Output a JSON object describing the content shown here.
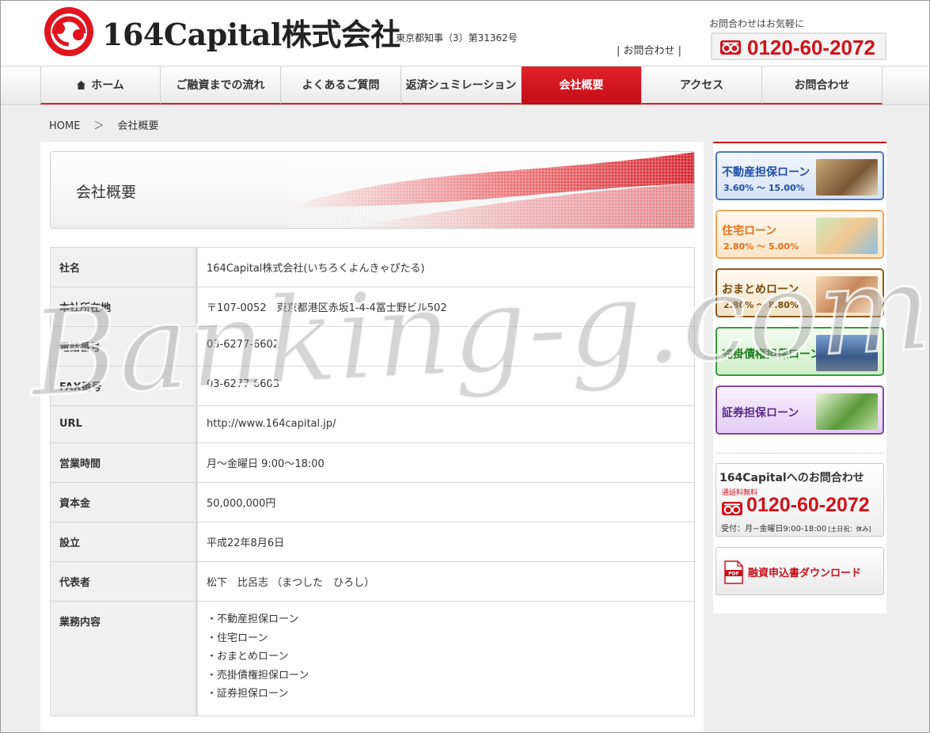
{
  "header": {
    "logo_text": "164Capital株式会社",
    "license": "東京都知事（3）第31362号",
    "contact_note": "お問合わせはお気軽に",
    "contact_link": "| お問合わせ |",
    "tel": "0120-60-2072"
  },
  "nav": {
    "items": [
      {
        "label": "ホーム",
        "icon": "home-icon",
        "active": false
      },
      {
        "label": "ご融資までの流れ",
        "active": false
      },
      {
        "label": "よくあるご質問",
        "active": false
      },
      {
        "label": "返済シュミレーション",
        "active": false
      },
      {
        "label": "会社概要",
        "active": true
      },
      {
        "label": "アクセス",
        "active": false
      },
      {
        "label": "お問合わせ",
        "active": false
      }
    ]
  },
  "breadcrumb": {
    "home": "HOME",
    "sep": "＞",
    "current": "会社概要"
  },
  "main": {
    "title": "会社概要",
    "rows": [
      {
        "label": "社名",
        "value": "164Capital株式会社(いちろくよんきゃぴたる)"
      },
      {
        "label": "本社所在地",
        "value": "〒107-0052　東京都港区赤坂1-4-4冨士野ビル502"
      },
      {
        "label": "電話番号",
        "value": "03-6277-6602"
      },
      {
        "label": "FAX番号",
        "value": "03-6277-6603"
      },
      {
        "label": "URL",
        "value": "http://www.164capital.jp/"
      },
      {
        "label": "営業時間",
        "value": "月～金曜日 9:00～18:00"
      },
      {
        "label": "資本金",
        "value": "50,000,000円"
      },
      {
        "label": "設立",
        "value": "平成22年8月6日"
      },
      {
        "label": "代表者",
        "value": "松下　比呂志 （まつした　ひろし）"
      }
    ],
    "business": {
      "label": "業務内容",
      "items": [
        "・不動産担保ローン",
        "・住宅ローン",
        "・おまとめローン",
        "・売掛債権担保ローン",
        "・証券担保ローン"
      ]
    }
  },
  "sidebar": {
    "banners": [
      {
        "title": "不動産担保ローン",
        "rate": "3.60% ～ 15.00%"
      },
      {
        "title": "住宅ローン",
        "rate": "2.80% ～ 5.00%"
      },
      {
        "title": "おまとめローン",
        "rate": "2.80% ～ 8.80%"
      },
      {
        "title": "売掛債権担保ローン",
        "rate": ""
      },
      {
        "title": "証券担保ローン",
        "rate": ""
      }
    ],
    "contact": {
      "title": "164Capitalへのお問合わせ",
      "free": "通話料無料",
      "tel": "0120-60-2072",
      "hours": "受付：月~金曜日9:00-18:00",
      "closed": "[土日祝：休み]"
    },
    "download": {
      "label": "融資申込書ダウンロード",
      "pdf": "PDF"
    }
  },
  "watermark": "Banking-g.com",
  "colors": {
    "brand_red": "#d0121b",
    "nav_active": "#d9252e"
  }
}
